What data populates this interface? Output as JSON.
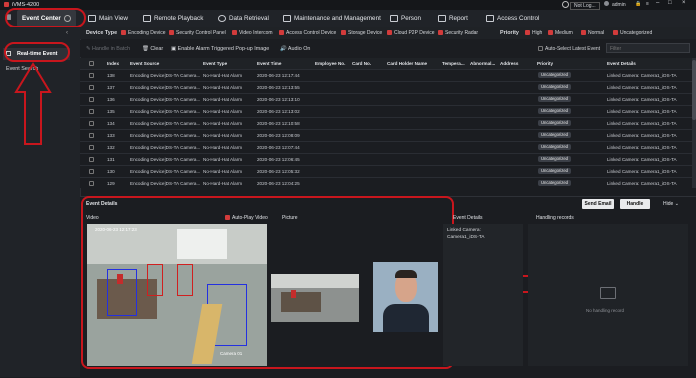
{
  "app": {
    "title": "iVMS-4200",
    "user_status": "Not Log...",
    "user": "admin"
  },
  "tabs": [
    {
      "label": "Event Center"
    },
    {
      "label": "Main View"
    },
    {
      "label": "Remote Playback"
    },
    {
      "label": "Data Retrieval"
    },
    {
      "label": "Maintenance and Management"
    },
    {
      "label": "Person"
    },
    {
      "label": "Report"
    },
    {
      "label": "Access Control"
    }
  ],
  "sidebar": {
    "items": [
      {
        "label": "Real-time Event"
      },
      {
        "label": "Event Search"
      }
    ]
  },
  "filters": {
    "device_type_label": "Device Type",
    "device_types": [
      "Encoding Device",
      "Security Control Panel",
      "Video Intercom",
      "Access Control Device",
      "Storage Device",
      "Cloud P2P Device",
      "Security Radar"
    ],
    "priority_label": "Priority",
    "priorities": [
      "High",
      "Medium",
      "Normal",
      "Uncategorized"
    ]
  },
  "toolbar": {
    "handle_in_batch": "Handle in Batch",
    "clear": "Clear",
    "popup": "Enable Alarm Triggered Pop-up Image",
    "audio": "Audio On",
    "auto_select": "Auto-Select Latest Event",
    "filter_placeholder": "Filter"
  },
  "table": {
    "columns": [
      "Index",
      "Event Source",
      "Event Type",
      "Event Time",
      "Employee No.",
      "Card No.",
      "Card Holder Name",
      "Tempera...",
      "Abnormal...",
      "Address",
      "Priority",
      "Event Details"
    ],
    "rows": [
      {
        "index": "138",
        "source": "Encoding Device|DS-TA Camera...",
        "type": "No-Hard-Hat Alarm",
        "time": "2020-06-23 12:17:44",
        "priority": "Uncategorized",
        "details": "Linked Camera: Camera1_iDS-TA"
      },
      {
        "index": "137",
        "source": "Encoding Device|DS-TA Camera...",
        "type": "No-Hard-Hat Alarm",
        "time": "2020-06-23 12:13:55",
        "priority": "Uncategorized",
        "details": "Linked Camera: Camera1_iDS-TA"
      },
      {
        "index": "136",
        "source": "Encoding Device|DS-TA Camera...",
        "type": "No-Hard-Hat Alarm",
        "time": "2020-06-23 12:13:10",
        "priority": "Uncategorized",
        "details": "Linked Camera: Camera1_iDS-TA"
      },
      {
        "index": "135",
        "source": "Encoding Device|DS-TA Camera...",
        "type": "No-Hard-Hat Alarm",
        "time": "2020-06-23 12:13:02",
        "priority": "Uncategorized",
        "details": "Linked Camera: Camera1_iDS-TA"
      },
      {
        "index": "134",
        "source": "Encoding Device|DS-TA Camera...",
        "type": "No-Hard-Hat Alarm",
        "time": "2020-06-23 12:10:58",
        "priority": "Uncategorized",
        "details": "Linked Camera: Camera1_iDS-TA"
      },
      {
        "index": "133",
        "source": "Encoding Device|DS-TA Camera...",
        "type": "No-Hard-Hat Alarm",
        "time": "2020-06-23 12:08:09",
        "priority": "Uncategorized",
        "details": "Linked Camera: Camera1_iDS-TA"
      },
      {
        "index": "132",
        "source": "Encoding Device|DS-TA Camera...",
        "type": "No-Hard-Hat Alarm",
        "time": "2020-06-23 12:07:44",
        "priority": "Uncategorized",
        "details": "Linked Camera: Camera1_iDS-TA"
      },
      {
        "index": "131",
        "source": "Encoding Device|DS-TA Camera...",
        "type": "No-Hard-Hat Alarm",
        "time": "2020-06-23 12:06:45",
        "priority": "Uncategorized",
        "details": "Linked Camera: Camera1_iDS-TA"
      },
      {
        "index": "130",
        "source": "Encoding Device|DS-TA Camera...",
        "type": "No-Hard-Hat Alarm",
        "time": "2020-06-23 12:05:32",
        "priority": "Uncategorized",
        "details": "Linked Camera: Camera1_iDS-TA"
      },
      {
        "index": "129",
        "source": "Encoding Device|DS-TA Camera...",
        "type": "No-Hard-Hat Alarm",
        "time": "2020-06-23 12:04:25",
        "priority": "Uncategorized",
        "details": "Linked Camera: Camera1_iDS-TA"
      }
    ]
  },
  "details": {
    "title": "Event Details",
    "send_email": "Send Email",
    "handle": "Handle",
    "hide": "Hide",
    "video_label": "Video",
    "autoplay": "Auto-Play Video",
    "picture_label": "Picture",
    "event_details_label": "Event Details",
    "linked_camera": "Linked Camera:",
    "camera_name": "Camera1_iDS-TA",
    "handling_records": "Handling records",
    "no_records": "No handling record",
    "video_timestamp": "2020-06-23  12:17:23",
    "video_caption": "Camera 01"
  },
  "colors": {
    "accent": "#c8161d",
    "badge": "#3b3f47"
  }
}
